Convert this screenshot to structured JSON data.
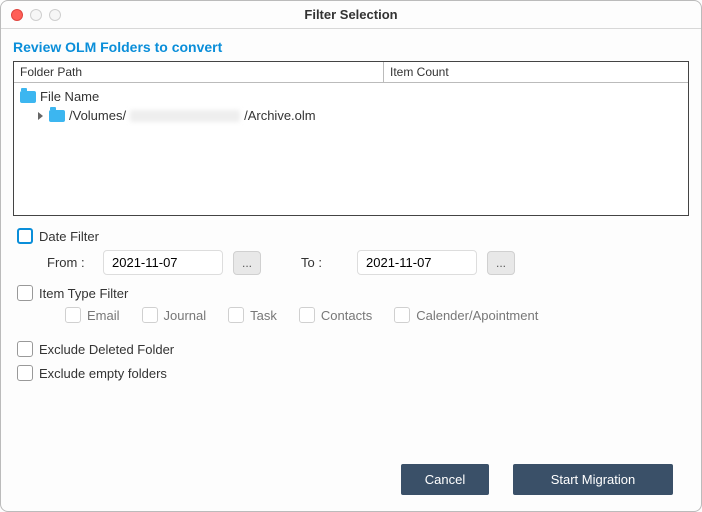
{
  "window": {
    "title": "Filter Selection"
  },
  "header": {
    "review_label": "Review OLM Folders to convert"
  },
  "folder_table": {
    "columns": {
      "path": "Folder Path",
      "count": "Item Count"
    },
    "root": {
      "name": "File Name",
      "child_prefix": "/Volumes/",
      "child_suffix": "/Archive.olm"
    }
  },
  "filters": {
    "date": {
      "label": "Date Filter",
      "from_label": "From :",
      "to_label": "To :",
      "from_value": "2021-11-07",
      "to_value": "2021-11-07",
      "picker_btn": "..."
    },
    "item_type": {
      "label": "Item Type Filter",
      "options": {
        "email": "Email",
        "journal": "Journal",
        "task": "Task",
        "contacts": "Contacts",
        "calendar": "Calender/Apointment"
      }
    },
    "exclude_deleted": "Exclude Deleted Folder",
    "exclude_empty": "Exclude empty folders"
  },
  "buttons": {
    "cancel": "Cancel",
    "start": "Start Migration"
  }
}
